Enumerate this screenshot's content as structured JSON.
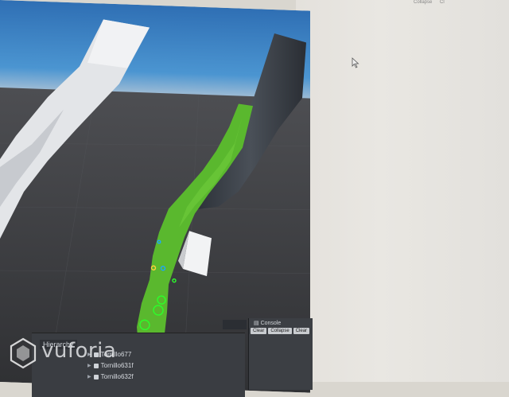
{
  "paper": {
    "top_labels": [
      "Collapse",
      "Cl"
    ]
  },
  "hierarchy": {
    "tab_label": "Hierarchy",
    "items": [
      {
        "label": "Tornillo677"
      },
      {
        "label": "Tornillo631f"
      },
      {
        "label": "Tornillo632f"
      }
    ]
  },
  "console": {
    "tab_label": "Console",
    "toolbar": [
      "Clear",
      "Collapse",
      "Clear"
    ]
  },
  "watermark": {
    "brand": "vuforia"
  },
  "colors": {
    "part_green": "#5ab82e",
    "gray_part": "#dcdfe3",
    "dark_part": "#3a4048",
    "sky": "#3f86c8",
    "floor": "#3e3f43"
  }
}
